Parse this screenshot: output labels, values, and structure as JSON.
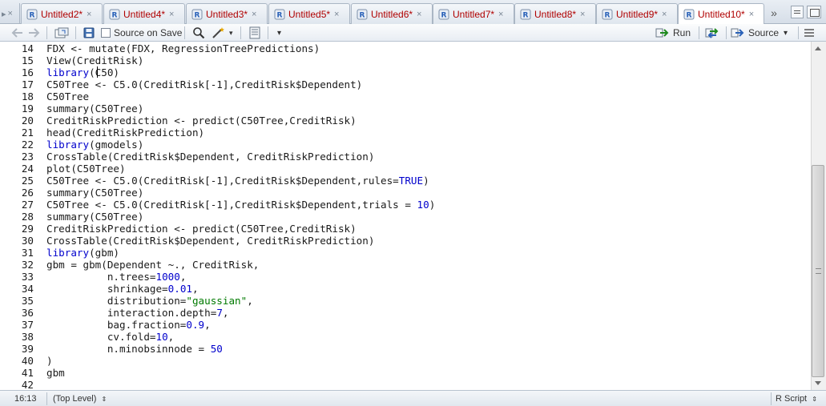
{
  "tabs": [
    {
      "label": "Untitled2*",
      "left": 0
    },
    {
      "label": "Untitled4*"
    },
    {
      "label": "Untitled3*"
    },
    {
      "label": "Untitled5*"
    },
    {
      "label": "Untitled6*"
    },
    {
      "label": "Untitled7*"
    },
    {
      "label": "Untitled8*"
    },
    {
      "label": "Untitled9*"
    },
    {
      "label": "Untitled10*"
    }
  ],
  "tab_close_glyph": "×",
  "tab_overflow_glyph": "»",
  "toolbar": {
    "source_on_save": "Source on Save",
    "run": "Run",
    "source": "Source"
  },
  "editor": {
    "lines": [
      {
        "n": "14",
        "html": "FDX <- mutate(FDX, RegressionTreePredictions)"
      },
      {
        "n": "15",
        "html": "View(CreditRisk)"
      },
      {
        "n": "16",
        "html": "<span class=\"kw\">library</span>(C50)"
      },
      {
        "n": "17",
        "html": "C50Tree <- C5.0(CreditRisk[-1],CreditRisk$Dependent)"
      },
      {
        "n": "18",
        "html": "C50Tree"
      },
      {
        "n": "19",
        "html": "summary(C50Tree)"
      },
      {
        "n": "20",
        "html": "CreditRiskPrediction <- predict(C50Tree,CreditRisk)"
      },
      {
        "n": "21",
        "html": "head(CreditRiskPrediction)"
      },
      {
        "n": "22",
        "html": "<span class=\"kw\">library</span>(gmodels)"
      },
      {
        "n": "23",
        "html": "CrossTable(CreditRisk$Dependent, CreditRiskPrediction)"
      },
      {
        "n": "24",
        "html": "plot(C50Tree)"
      },
      {
        "n": "25",
        "html": "C50Tree <- C5.0(CreditRisk[-1],CreditRisk$Dependent,rules=<span class=\"kw\">TRUE</span>)"
      },
      {
        "n": "26",
        "html": "summary(C50Tree)"
      },
      {
        "n": "27",
        "html": "C50Tree <- C5.0(CreditRisk[-1],CreditRisk$Dependent,trials = <span class=\"num\">10</span>)"
      },
      {
        "n": "28",
        "html": "summary(C50Tree)"
      },
      {
        "n": "29",
        "html": "CreditRiskPrediction <- predict(C50Tree,CreditRisk)"
      },
      {
        "n": "30",
        "html": "CrossTable(CreditRisk$Dependent, CreditRiskPrediction)"
      },
      {
        "n": "31",
        "html": "<span class=\"kw\">library</span>(gbm)"
      },
      {
        "n": "32",
        "html": "gbm = gbm(Dependent ~., CreditRisk,"
      },
      {
        "n": "33",
        "html": "          n.trees=<span class=\"num\">1000</span>,"
      },
      {
        "n": "34",
        "html": "          shrinkage=<span class=\"num\">0.01</span>,"
      },
      {
        "n": "35",
        "html": "          distribution=<span class=\"str\">\"gaussian\"</span>,"
      },
      {
        "n": "36",
        "html": "          interaction.depth=<span class=\"num\">7</span>,"
      },
      {
        "n": "37",
        "html": "          bag.fraction=<span class=\"num\">0.9</span>,"
      },
      {
        "n": "38",
        "html": "          cv.fold=<span class=\"num\">10</span>,"
      },
      {
        "n": "39",
        "html": "          n.minobsinnode = <span class=\"num\">50</span>"
      },
      {
        "n": "40",
        "html": ")"
      },
      {
        "n": "41",
        "html": "gbm"
      },
      {
        "n": "42",
        "html": ""
      }
    ]
  },
  "status": {
    "position": "16:13",
    "scope": "(Top Level)",
    "filetype": "R Script"
  },
  "colors": {
    "tab_label": "#b00000",
    "keyword": "#0000cc",
    "string": "#007a00"
  }
}
